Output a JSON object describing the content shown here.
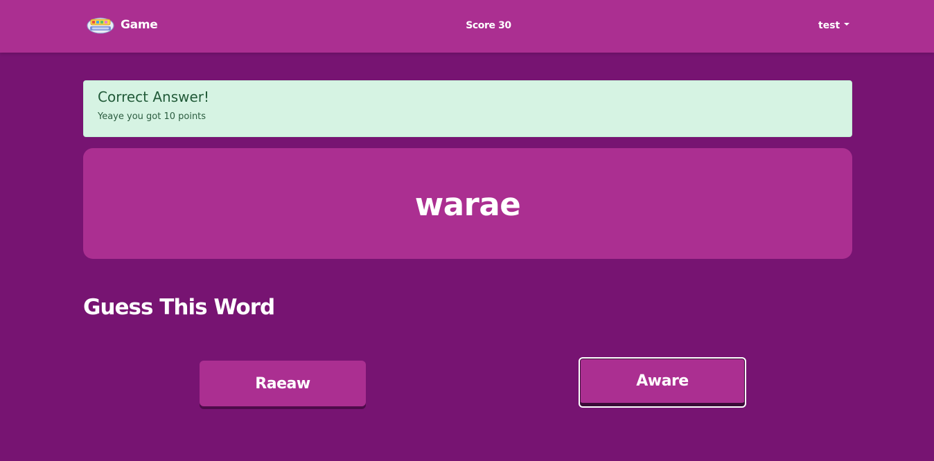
{
  "header": {
    "brand_label": "Game",
    "score_text": "Score 30",
    "user_name": "test"
  },
  "alert": {
    "heading": "Correct Answer!",
    "message": "Yeaye you got 10 points"
  },
  "puzzle": {
    "scrambled_word": "warae"
  },
  "section": {
    "title": "Guess This Word"
  },
  "answers": [
    {
      "label": "Raeaw"
    },
    {
      "label": "Aware"
    }
  ],
  "colors": {
    "page_background": "#771472",
    "navbar_background": "#ab2f91",
    "card_background": "#ab2f91",
    "alert_background": "#d6f3e3",
    "alert_text": "#215a38"
  },
  "icons": {
    "logo": "game-logo-icon",
    "dropdown": "caret-down-icon"
  }
}
